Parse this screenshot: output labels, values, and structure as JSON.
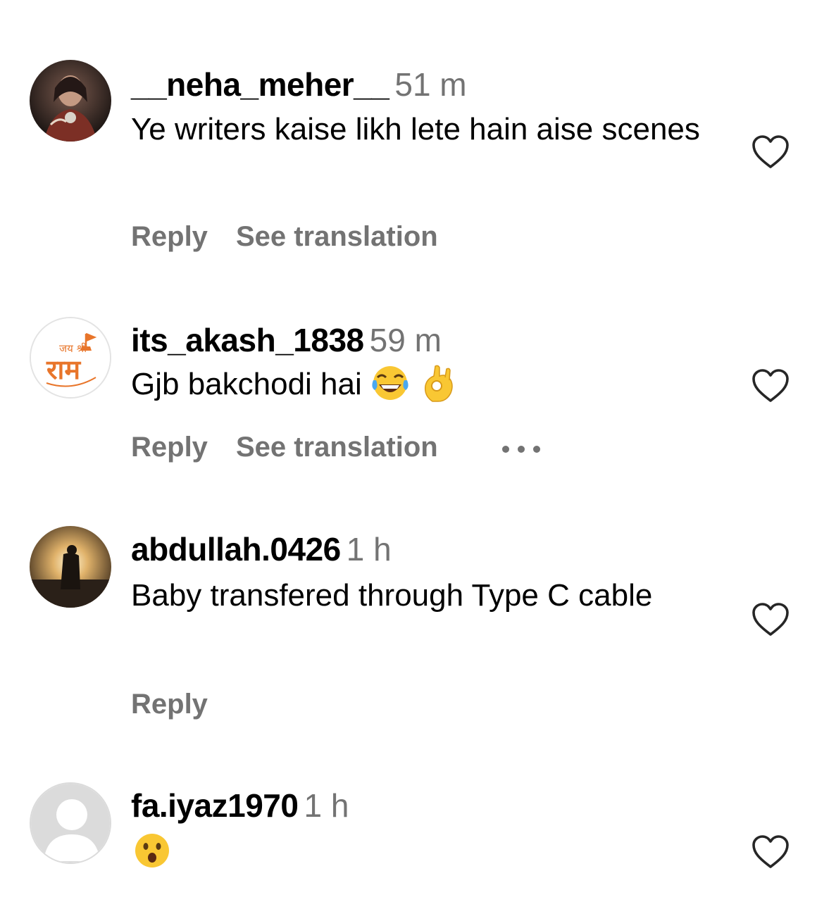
{
  "comments": [
    {
      "username": "__neha_meher__",
      "time": "51 m",
      "text": "Ye writers kaise likh lete hain aise scenes",
      "emojis": [],
      "reply_label": "Reply",
      "translation_label": "See translation",
      "avatar": "photo-portrait"
    },
    {
      "username": "its_akash_1838",
      "time": "59 m",
      "text": "Gjb bakchodi hai",
      "emojis": [
        "tears-of-joy-emoji",
        "ok-hand-emoji"
      ],
      "reply_label": "Reply",
      "translation_label": "See translation",
      "avatar": "jai-shri-ram-logo"
    },
    {
      "username": "abdullah.0426",
      "time": "1 h",
      "text": "Baby transfered through Type C cable",
      "emojis": [],
      "reply_label": "Reply",
      "avatar": "sunset-silhouette-photo"
    },
    {
      "username": "fa.iyaz1970",
      "time": "1 h",
      "text": "",
      "emojis": [
        "surprised-face-emoji"
      ],
      "avatar": "default-avatar"
    }
  ],
  "avatar_logo_text": {
    "top": "जय श्री",
    "main": "राम"
  },
  "icons": {
    "like": "heart-outline-icon",
    "more": "more-options-icon"
  },
  "colors": {
    "secondary_text": "#737373",
    "primary_text": "#000000",
    "heart_stroke": "#262626",
    "logo_orange": "#e8752a"
  }
}
